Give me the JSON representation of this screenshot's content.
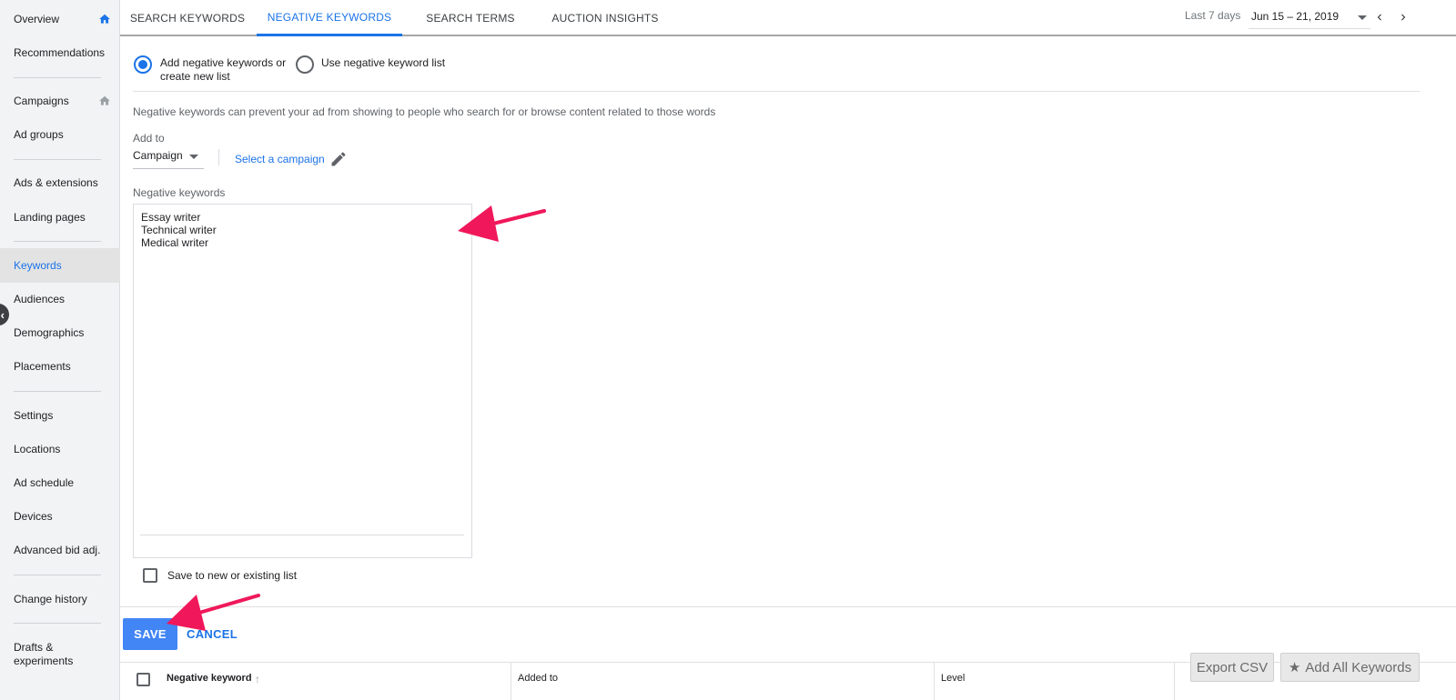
{
  "sidebar": {
    "items": [
      {
        "label": "Overview"
      },
      {
        "label": "Recommendations"
      },
      {
        "label": "Campaigns"
      },
      {
        "label": "Ad groups"
      },
      {
        "label": "Ads & extensions"
      },
      {
        "label": "Landing pages"
      },
      {
        "label": "Keywords"
      },
      {
        "label": "Audiences"
      },
      {
        "label": "Demographics"
      },
      {
        "label": "Placements"
      },
      {
        "label": "Settings"
      },
      {
        "label": "Locations"
      },
      {
        "label": "Ad schedule"
      },
      {
        "label": "Devices"
      },
      {
        "label": "Advanced bid adj."
      },
      {
        "label": "Change history"
      },
      {
        "label": "Drafts &\nexperiments"
      }
    ],
    "collapse_glyph": "‹"
  },
  "tabs": [
    {
      "label": "SEARCH KEYWORDS"
    },
    {
      "label": "NEGATIVE KEYWORDS"
    },
    {
      "label": "SEARCH TERMS"
    },
    {
      "label": "AUCTION INSIGHTS"
    }
  ],
  "date_range": {
    "label": "Last 7 days",
    "value": "Jun 15 – 21, 2019"
  },
  "form": {
    "option_add_line1": "Add negative keywords or",
    "option_add_line2": "create new list",
    "option_list": "Use negative keyword list",
    "description": "Negative keywords can prevent your ad from showing to people who search for or browse content related to those words",
    "add_to_label": "Add to",
    "level_value": "Campaign",
    "select_campaign": "Select a campaign",
    "negative_keywords_label": "Negative keywords",
    "keywords": [
      "Essay writer",
      "Technical writer",
      "Medical writer"
    ],
    "save_to_list": "Save to new or existing list"
  },
  "actions": {
    "save": "SAVE",
    "cancel": "CANCEL"
  },
  "table": {
    "columns": [
      "Negative keyword",
      "Added to",
      "Level"
    ],
    "sort_glyph": "↑"
  },
  "floating": {
    "export_csv": "Export CSV",
    "add_all_keywords": "Add All Keywords",
    "star_glyph": "★"
  },
  "colors": {
    "accent": "#1a73e8",
    "save_button": "#4285f4",
    "annotation_arrow": "#f0185a"
  }
}
